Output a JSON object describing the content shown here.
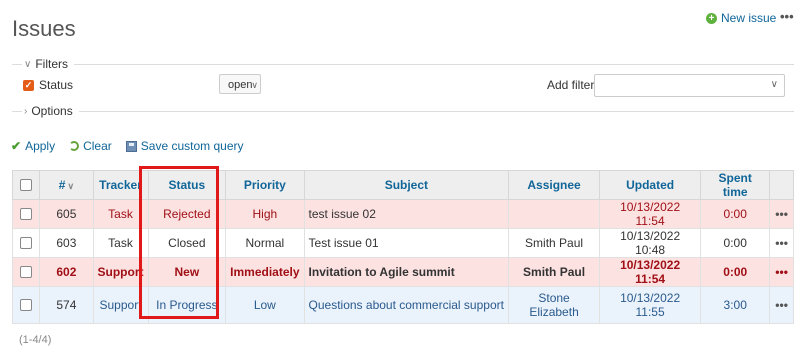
{
  "header": {
    "title": "Issues",
    "new_issue_label": "New issue",
    "more_label": "•••"
  },
  "filters": {
    "legend": "Filters",
    "status_label": "Status",
    "status_operator": "open",
    "add_filter_label": "Add filter",
    "add_filter_value": ""
  },
  "options": {
    "legend": "Options"
  },
  "actions": {
    "apply_label": "Apply",
    "clear_label": "Clear",
    "save_label": "Save custom query"
  },
  "table": {
    "columns": [
      "#",
      "Tracker",
      "Status",
      "Priority",
      "Subject",
      "Assignee",
      "Updated",
      "Spent time"
    ],
    "rows": [
      {
        "id": "605",
        "tracker": "Task",
        "status": "Rejected",
        "priority": "High",
        "subject": "test issue 02",
        "assignee": "",
        "updated": "10/13/2022 11:54",
        "spent": "0:00"
      },
      {
        "id": "603",
        "tracker": "Task",
        "status": "Closed",
        "priority": "Normal",
        "subject": "Test issue 01",
        "assignee": "Smith Paul",
        "updated": "10/13/2022 10:48",
        "spent": "0:00"
      },
      {
        "id": "602",
        "tracker": "Support",
        "status": "New",
        "priority": "Immediately",
        "subject": "Invitation to Agile summit",
        "assignee": "Smith Paul",
        "updated": "10/13/2022 11:54",
        "spent": "0:00"
      },
      {
        "id": "574",
        "tracker": "Support",
        "status": "In Progress",
        "priority": "Low",
        "subject": "Questions about commercial support",
        "assignee": "Stone Elizabeth",
        "updated": "10/13/2022 11:55",
        "spent": "3:00"
      }
    ],
    "row_more_label": "•••"
  },
  "pagination": {
    "label": "(1-4/4)"
  },
  "colors": {
    "link": "#116699",
    "highlight_box": "#e01818",
    "row_pink": "#fde2e2",
    "row_blue": "#eaf2fc"
  }
}
